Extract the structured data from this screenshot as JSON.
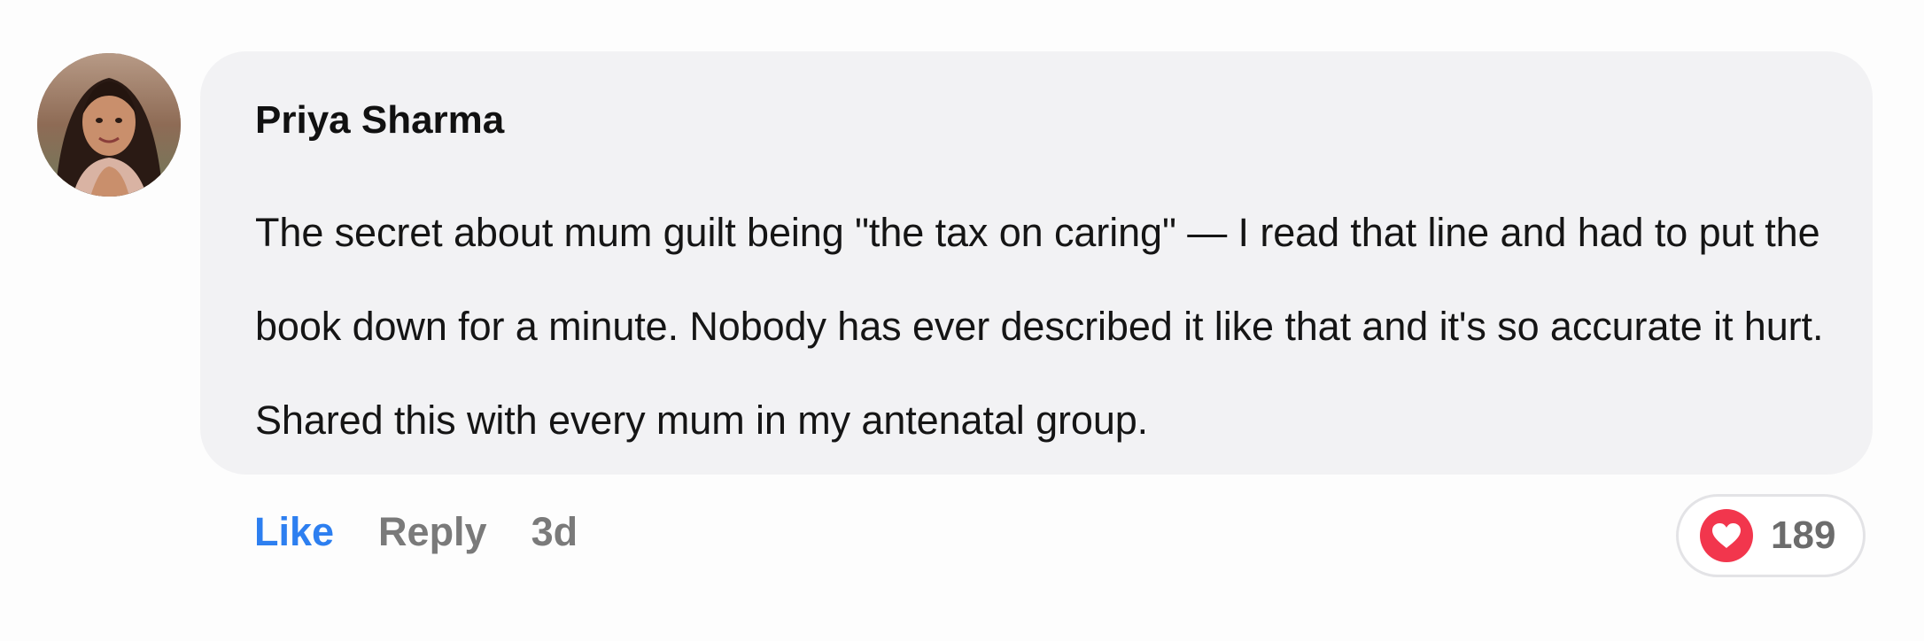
{
  "comment": {
    "author": "Priya Sharma",
    "text": "The secret about mum guilt being \"the tax on caring\" — I read that line and had to put the book down for a minute. Nobody has ever described it like that and it's so accurate it hurt. Shared this with every mum in my antenatal group.",
    "actions": {
      "like_label": "Like",
      "reply_label": "Reply",
      "timestamp": "3d"
    },
    "reactions": {
      "icon": "heart-icon",
      "count": "189"
    }
  },
  "colors": {
    "like_accent": "#2d7ff0",
    "heart": "#f2364d",
    "bubble_bg": "#f2f2f4"
  }
}
